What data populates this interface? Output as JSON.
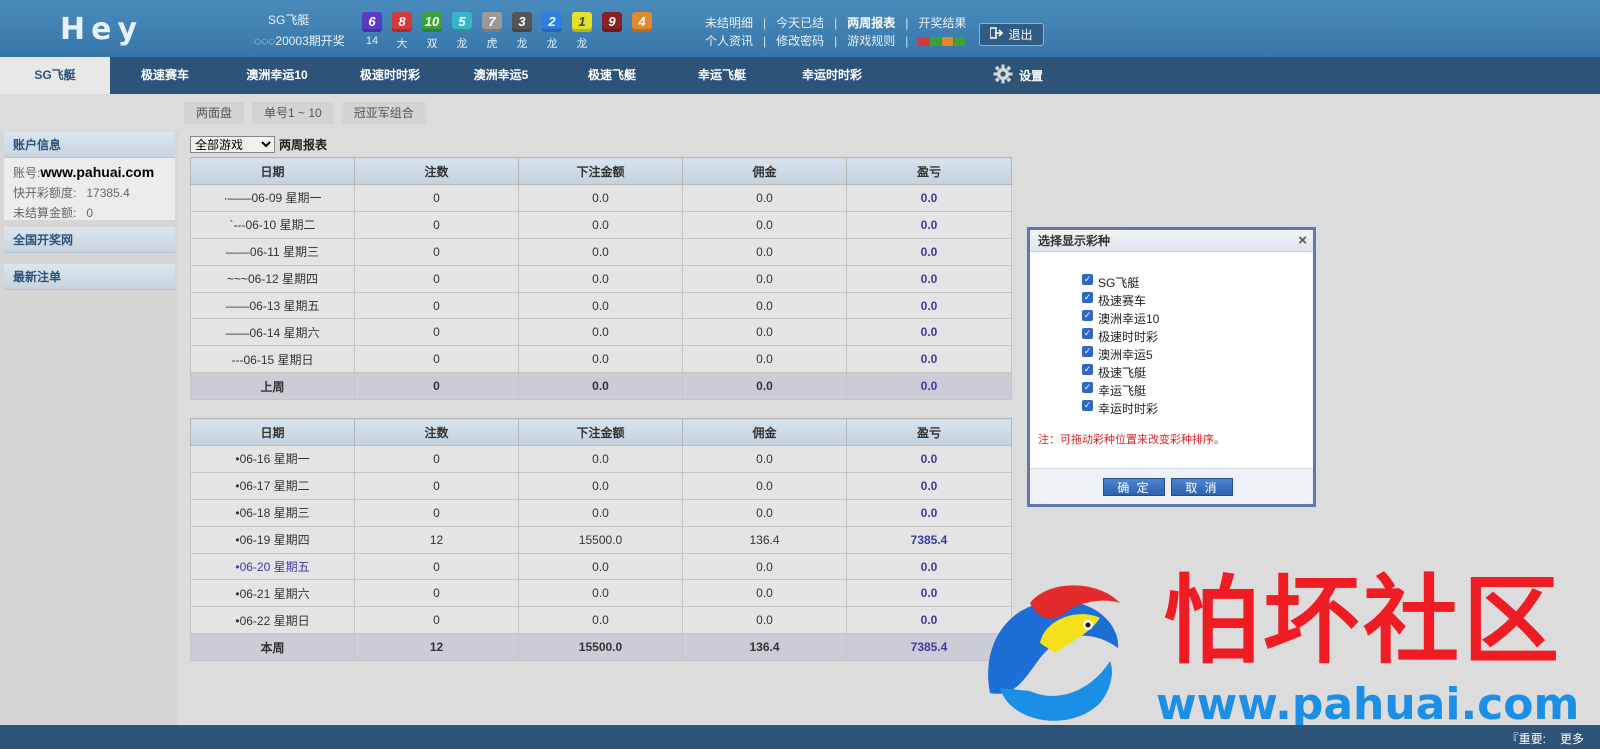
{
  "header": {
    "logo": "Hey",
    "lottery_name": "SG飞艇",
    "issue_text": "◌◌◌20003期开奖",
    "balls": [
      {
        "num": "6",
        "color": "#5a3cc8",
        "stat": "14"
      },
      {
        "num": "8",
        "color": "#d33a3a",
        "stat": "大"
      },
      {
        "num": "10",
        "color": "#3aa23a",
        "stat": "双"
      },
      {
        "num": "5",
        "color": "#35b6c8",
        "stat": "龙"
      },
      {
        "num": "7",
        "color": "#9a9a9a",
        "stat": "虎"
      },
      {
        "num": "3",
        "color": "#555555",
        "stat": "龙"
      },
      {
        "num": "2",
        "color": "#2f7fe0",
        "stat": "龙"
      },
      {
        "num": "1",
        "color": "#e6e02a",
        "stat": "龙"
      },
      {
        "num": "9",
        "color": "#8a2222",
        "stat": "",
        "hide_stat": true
      },
      {
        "num": "4",
        "color": "#e08a2e",
        "stat": "",
        "hide_stat": true
      }
    ],
    "links_row1": [
      "未结明细",
      "今天已结",
      "两周报表",
      "开奖结果"
    ],
    "links_row2": [
      "个人资讯",
      "修改密码",
      "游戏规则"
    ],
    "skin_colors": [
      "#d33a3a",
      "#3aa23a",
      "#e08a2e",
      "#3aa23a"
    ],
    "logout_label": "退出"
  },
  "nav": {
    "items": [
      "SG飞艇",
      "极速赛车",
      "澳洲幸运10",
      "极速时时彩",
      "澳洲幸运5",
      "极速飞艇",
      "幸运飞艇",
      "幸运时时彩"
    ],
    "settings_label": "设置"
  },
  "subtabs": [
    "两面盘",
    "单号1 ~ 10",
    "冠亚军组合"
  ],
  "sidebar": {
    "account_title": "账户信息",
    "account_label": "账号:",
    "account_value": "www.pahuai.com",
    "quota_label": "快开彩额度:",
    "quota_value": "17385.4",
    "unsettled_label": "未结算金额:",
    "unsettled_value": "0",
    "section2": "全国开奖网",
    "section3": "最新注单"
  },
  "filter": {
    "select_value": "全部游戏",
    "label": "两周报表"
  },
  "columns": [
    "日期",
    "注数",
    "下注金额",
    "佣金",
    "盈亏"
  ],
  "last_week": {
    "rows": [
      [
        "·——06-09 星期一",
        "0",
        "0.0",
        "0.0",
        "0.0"
      ],
      [
        "`---06-10 星期二",
        "0",
        "0.0",
        "0.0",
        "0.0"
      ],
      [
        "——06-11 星期三",
        "0",
        "0.0",
        "0.0",
        "0.0"
      ],
      [
        "~~~06-12 星期四",
        "0",
        "0.0",
        "0.0",
        "0.0"
      ],
      [
        "——06-13 星期五",
        "0",
        "0.0",
        "0.0",
        "0.0"
      ],
      [
        "——06-14 星期六",
        "0",
        "0.0",
        "0.0",
        "0.0"
      ],
      [
        "---06-15 星期日",
        "0",
        "0.0",
        "0.0",
        "0.0"
      ]
    ],
    "total": [
      "上周",
      "0",
      "0.0",
      "0.0",
      "0.0"
    ]
  },
  "this_week": {
    "rows": [
      [
        "•06-16 星期一",
        "0",
        "0.0",
        "0.0",
        "0.0"
      ],
      [
        "•06-17 星期二",
        "0",
        "0.0",
        "0.0",
        "0.0"
      ],
      [
        "•06-18 星期三",
        "0",
        "0.0",
        "0.0",
        "0.0"
      ],
      [
        "•06-19 星期四",
        "12",
        "15500.0",
        "136.4",
        "7385.4"
      ],
      [
        "•06-20 星期五",
        "0",
        "0.0",
        "0.0",
        "0.0"
      ],
      [
        "•06-21 星期六",
        "0",
        "0.0",
        "0.0",
        "0.0"
      ],
      [
        "•06-22 星期日",
        "0",
        "0.0",
        "0.0",
        "0.0"
      ]
    ],
    "total": [
      "本周",
      "12",
      "15500.0",
      "136.4",
      "7385.4"
    ]
  },
  "modal": {
    "title": "选择显示彩种",
    "close": "×",
    "items": [
      "SG飞艇",
      "极速赛车",
      "澳洲幸运10",
      "极速时时彩",
      "澳洲幸运5",
      "极速飞艇",
      "幸运飞艇",
      "幸运时时彩"
    ],
    "note": "注：可拖动彩种位置来改变彩种排序。",
    "confirm": "确 定",
    "cancel": "取 消"
  },
  "watermark": {
    "cn": "怕坏社区",
    "url": "www.pahuai.com"
  },
  "footer": {
    "text1": "『重要:",
    "text2": "更多"
  }
}
